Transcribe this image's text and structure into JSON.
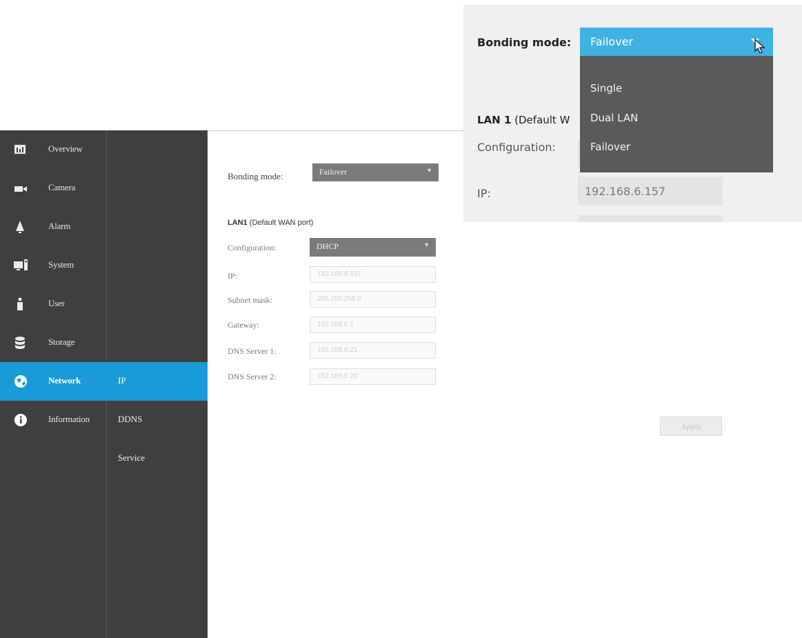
{
  "nav": {
    "items": [
      {
        "label": "Overview",
        "icon": "overview-icon"
      },
      {
        "label": "Camera",
        "icon": "camera-icon"
      },
      {
        "label": "Alarm",
        "icon": "alarm-icon"
      },
      {
        "label": "System",
        "icon": "system-icon"
      },
      {
        "label": "User",
        "icon": "user-icon"
      },
      {
        "label": "Storage",
        "icon": "storage-icon"
      },
      {
        "label": "Network",
        "icon": "network-icon",
        "active": true
      },
      {
        "label": "Information",
        "icon": "information-icon"
      }
    ],
    "sub_items": [
      {
        "label": "IP",
        "active": true
      },
      {
        "label": "DDNS"
      },
      {
        "label": "Service"
      }
    ]
  },
  "content": {
    "bonding_label": "Bonding mode:",
    "bonding_value": "Failover",
    "lan_title_bold": "LAN1",
    "lan_title_rest": " (Default WAN port)",
    "config_label": "Configuration:",
    "config_value": "DHCP",
    "fields": [
      {
        "label": "IP:",
        "value": "192.168.6.157"
      },
      {
        "label": "Subnet mask:",
        "value": "255.255.255.0"
      },
      {
        "label": "Gateway:",
        "value": "192.168.6.1"
      },
      {
        "label": "DNS Server 1:",
        "value": "192.168.6.21"
      },
      {
        "label": "DNS Server 2:",
        "value": "192.168.6.20"
      }
    ],
    "apply_label": "Apply"
  },
  "zoom": {
    "bonding_label": "Bonding mode:",
    "bonding_value": "Failover",
    "options": [
      "Single",
      "Dual LAN",
      "Failover"
    ],
    "lan_title_bold": "LAN 1",
    "lan_title_rest": "  (Default W",
    "config_label": "Configuration:",
    "ip_label": "IP:",
    "ip_value": "192.168.6.157"
  },
  "colors": {
    "sidebar": "#3f3f3f",
    "active": "#1a9bd7",
    "select_accent": "#3fb1e3",
    "dropdown": "#5a5a5a"
  }
}
